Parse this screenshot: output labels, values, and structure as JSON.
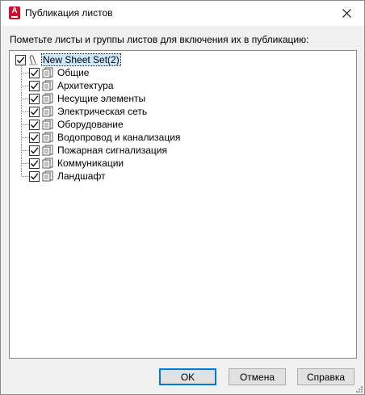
{
  "window": {
    "title": "Публикация листов"
  },
  "instruction": "Пометьте листы и группы листов для включения их в публикацию:",
  "tree": {
    "root": {
      "label": "New Sheet Set(2)",
      "checked": true
    },
    "items": [
      {
        "label": "Общие",
        "checked": true
      },
      {
        "label": "Архитектура",
        "checked": true
      },
      {
        "label": "Несущие элементы",
        "checked": true
      },
      {
        "label": "Электрическая сеть",
        "checked": true
      },
      {
        "label": "Оборудование",
        "checked": true
      },
      {
        "label": "Водопровод и канализация",
        "checked": true
      },
      {
        "label": "Пожарная сигнализация",
        "checked": true
      },
      {
        "label": "Коммуникации",
        "checked": true
      },
      {
        "label": "Ландшафт",
        "checked": true
      }
    ]
  },
  "buttons": {
    "ok": "OK",
    "cancel": "Отмена",
    "help": "Справка"
  }
}
